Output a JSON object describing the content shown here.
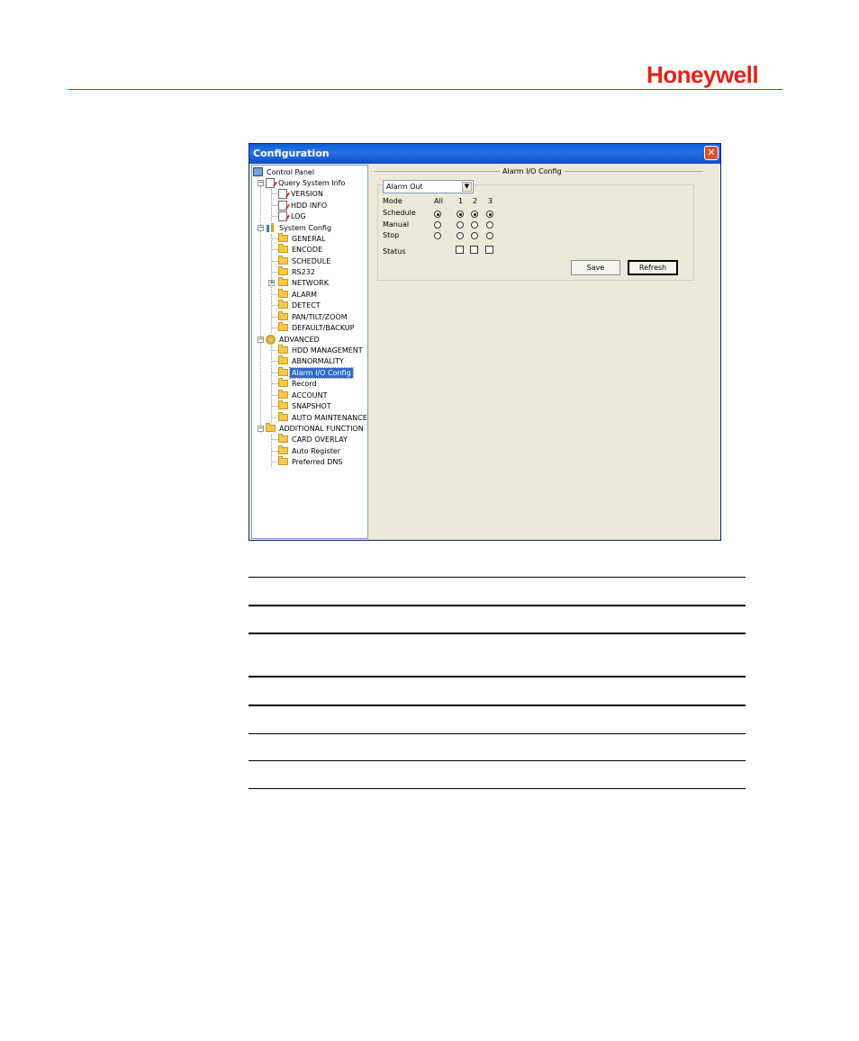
{
  "brand": {
    "name": "Honeywell",
    "color": "#e2231a"
  },
  "window": {
    "title": "Configuration",
    "close_glyph": "✕"
  },
  "tree": {
    "items": [
      {
        "label": "Control Panel"
      },
      {
        "label": "Query System Info"
      },
      {
        "label": "VERSION"
      },
      {
        "label": "HDD INFO"
      },
      {
        "label": "LOG"
      },
      {
        "label": "System Config"
      },
      {
        "label": "GENERAL"
      },
      {
        "label": "ENCODE"
      },
      {
        "label": "SCHEDULE"
      },
      {
        "label": "RS232"
      },
      {
        "label": "NETWORK"
      },
      {
        "label": "ALARM"
      },
      {
        "label": "DETECT"
      },
      {
        "label": "PAN/TILT/ZOOM"
      },
      {
        "label": "DEFAULT/BACKUP"
      },
      {
        "label": "ADVANCED"
      },
      {
        "label": "HDD MANAGEMENT"
      },
      {
        "label": "ABNORMALITY"
      },
      {
        "label": "Alarm I/O Config"
      },
      {
        "label": "Record"
      },
      {
        "label": "ACCOUNT"
      },
      {
        "label": "SNAPSHOT"
      },
      {
        "label": "AUTO MAINTENANCE"
      },
      {
        "label": "ADDITIONAL FUNCTION"
      },
      {
        "label": "CARD OVERLAY"
      },
      {
        "label": "Auto Register"
      },
      {
        "label": "Preferred DNS"
      }
    ],
    "selected": "Alarm I/O Config"
  },
  "panel": {
    "title": "Alarm I/O Config",
    "type_select": {
      "value": "Alarm Out"
    },
    "mode_label": "Mode",
    "columns": [
      "All",
      "1",
      "2",
      "3"
    ],
    "rows": [
      {
        "label": "Schedule",
        "all": true,
        "channels": [
          true,
          true,
          true
        ]
      },
      {
        "label": "Manual",
        "all": false,
        "channels": [
          false,
          false,
          false
        ]
      },
      {
        "label": "Stop",
        "all": false,
        "channels": [
          false,
          false,
          false
        ]
      }
    ],
    "status_label": "Status",
    "status": [
      false,
      false,
      false
    ],
    "save_label": "Save",
    "refresh_label": "Refresh"
  }
}
